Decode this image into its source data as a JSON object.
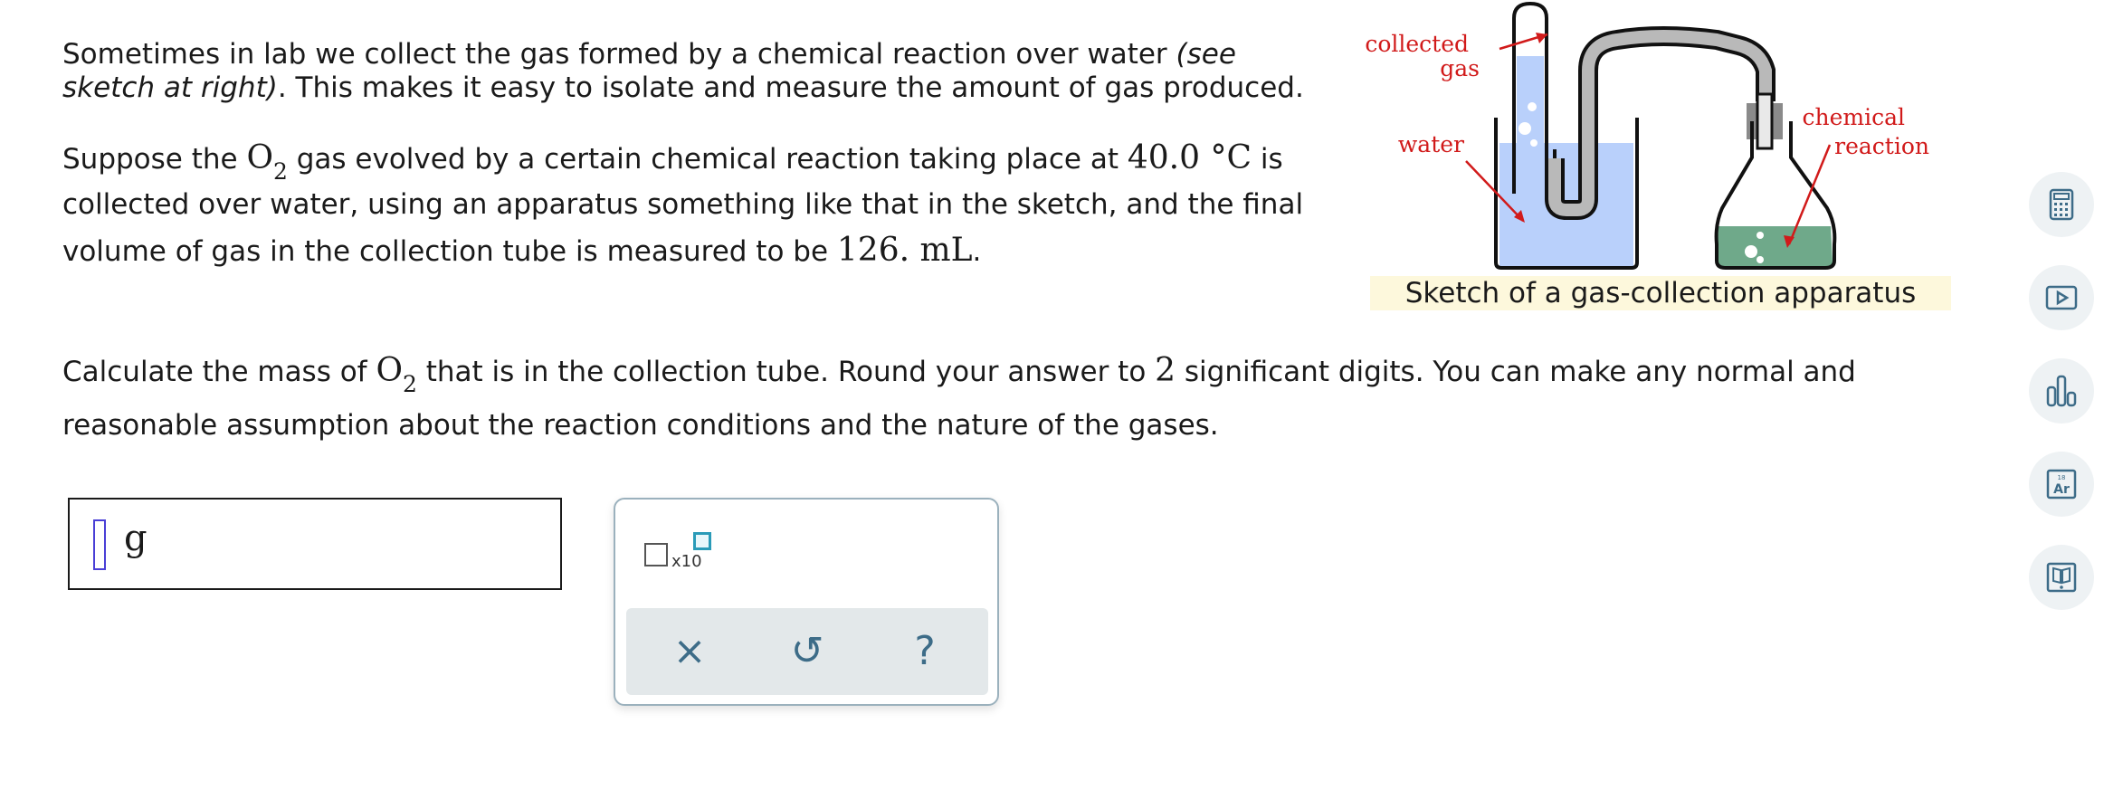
{
  "question": {
    "p1_a": "Sometimes in lab we collect the gas formed by a chemical reaction over water ",
    "p1_em": "(see sketch at right)",
    "p1_b": ". This makes it easy to isolate and measure the amount of gas produced.",
    "p2_a": "Suppose the ",
    "p2_gas": "O",
    "p2_gas_sub": "2",
    "p2_b": " gas evolved by a certain chemical reaction taking place at ",
    "p2_temp": "40.0 °C",
    "p2_c": " is collected over water, using an apparatus something like that in the sketch, and the final volume of gas in the collection tube is measured to be ",
    "p2_vol": "126. mL",
    "p2_d": ".",
    "p3_a": "Calculate the mass of ",
    "p3_gas": "O",
    "p3_gas_sub": "2",
    "p3_b": " that is in the collection tube. Round your answer to ",
    "p3_sig": "2",
    "p3_c": " significant digits. You can make any normal and reasonable assumption about the reaction conditions and the nature of the gases."
  },
  "sketch": {
    "label_collected_1": "collected",
    "label_collected_2": "gas",
    "label_water": "water",
    "label_chem_1": "chemical",
    "label_chem_2": "reaction",
    "caption": "Sketch of a gas-collection apparatus",
    "water_color": "#b9d0fb",
    "reaction_color": "#6fa98a",
    "label_color": "#d11a1a"
  },
  "answer": {
    "unit": "g",
    "value": ""
  },
  "panel": {
    "sci_label": "x10",
    "clear_symbol": "×",
    "undo_symbol": "↺",
    "help_symbol": "?"
  },
  "right_tools": [
    {
      "name": "calculator-icon"
    },
    {
      "name": "video-icon"
    },
    {
      "name": "chart-icon"
    },
    {
      "name": "periodic-table-icon",
      "number": "18",
      "symbol": "Ar"
    },
    {
      "name": "ebook-icon"
    }
  ]
}
